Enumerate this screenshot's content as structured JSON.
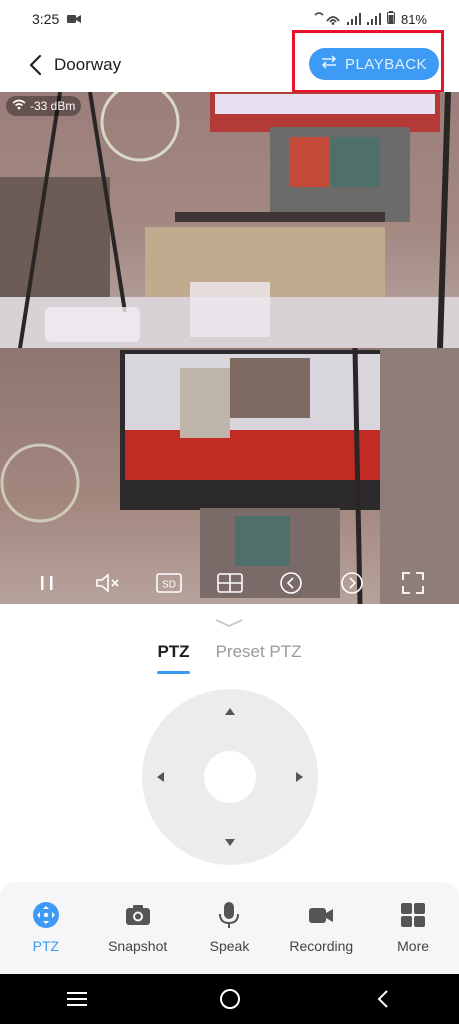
{
  "status_bar": {
    "time": "3:25",
    "battery": "81%"
  },
  "header": {
    "title": "Doorway",
    "playback_label": "PLAYBACK"
  },
  "video": {
    "signal_text": "-33 dBm",
    "controls": [
      "pause-icon",
      "mute-icon",
      "sd-quality-icon",
      "split-view-icon",
      "previous-icon",
      "next-icon",
      "fullscreen-icon"
    ],
    "quality_label": "SD"
  },
  "ptz_tabs": {
    "active": "PTZ",
    "inactive": "Preset PTZ"
  },
  "bottom_tabs": {
    "items": [
      {
        "label": "PTZ",
        "icon": "move-icon"
      },
      {
        "label": "Snapshot",
        "icon": "camera-icon"
      },
      {
        "label": "Speak",
        "icon": "microphone-icon"
      },
      {
        "label": "Recording",
        "icon": "video-record-icon"
      },
      {
        "label": "More",
        "icon": "grid-icon"
      }
    ]
  },
  "colors": {
    "accent": "#3e9bf5",
    "highlight_border": "#e8102a"
  }
}
